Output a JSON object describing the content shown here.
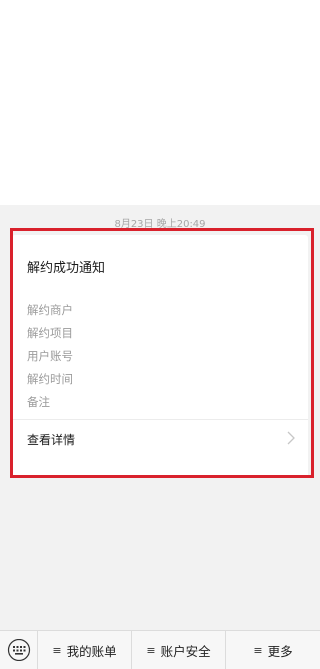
{
  "chat": {
    "timestamp": "8月23日 晚上20:49"
  },
  "card": {
    "title": "解约成功通知",
    "fields": [
      "解约商户",
      "解约项目",
      "用户账号",
      "解约时间",
      "备注"
    ],
    "detail_label": "查看详情"
  },
  "bottom_menu": {
    "items": [
      {
        "icon": "≡",
        "label": "我的账单"
      },
      {
        "icon": "≡",
        "label": "账户安全"
      },
      {
        "icon": "≡",
        "label": "更多"
      }
    ]
  },
  "colors": {
    "highlight": "#d9212c",
    "chat_bg": "#f2f2f2"
  }
}
